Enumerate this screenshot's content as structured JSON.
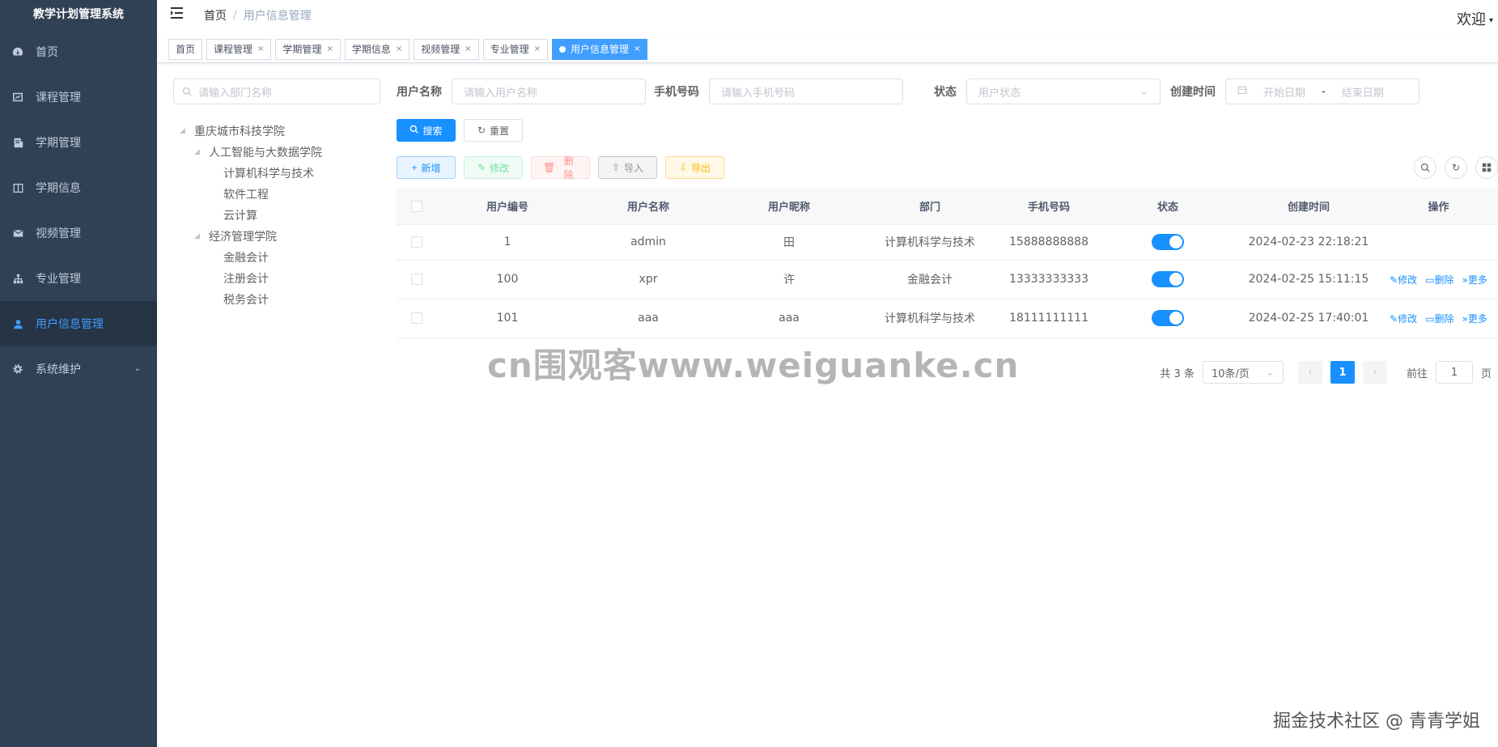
{
  "app": {
    "title": "教学计划管理系统"
  },
  "sidebar": {
    "items": [
      {
        "label": "首页",
        "icon": "dashboard-icon"
      },
      {
        "label": "课程管理",
        "icon": "chart-icon"
      },
      {
        "label": "学期管理",
        "icon": "document-icon"
      },
      {
        "label": "学期信息",
        "icon": "book-icon"
      },
      {
        "label": "视频管理",
        "icon": "mail-icon"
      },
      {
        "label": "专业管理",
        "icon": "tree-icon"
      },
      {
        "label": "用户信息管理",
        "icon": "user-icon",
        "active": true
      },
      {
        "label": "系统维护",
        "icon": "gear-icon"
      }
    ]
  },
  "header": {
    "breadcrumb_home": "首页",
    "breadcrumb_sep": "/",
    "breadcrumb_current": "用户信息管理",
    "welcome": "欢迎"
  },
  "tags": [
    {
      "label": "首页"
    },
    {
      "label": "课程管理"
    },
    {
      "label": "学期管理"
    },
    {
      "label": "学期信息"
    },
    {
      "label": "视频管理"
    },
    {
      "label": "专业管理"
    },
    {
      "label": "用户信息管理",
      "active": true
    }
  ],
  "tree": {
    "placeholder": "请输入部门名称",
    "nodes": [
      {
        "label": "重庆城市科技学院",
        "level": 0
      },
      {
        "label": "人工智能与大数据学院",
        "level": 1
      },
      {
        "label": "计算机科学与技术",
        "level": 2
      },
      {
        "label": "软件工程",
        "level": 2
      },
      {
        "label": "云计算",
        "level": 2
      },
      {
        "label": "经济管理学院",
        "level": 1
      },
      {
        "label": "金融会计",
        "level": 2
      },
      {
        "label": "注册会计",
        "level": 2
      },
      {
        "label": "税务会计",
        "level": 2
      }
    ]
  },
  "search": {
    "username_label": "用户名称",
    "username_placeholder": "请输入用户名称",
    "phone_label": "手机号码",
    "phone_placeholder": "请输入手机号码",
    "status_label": "状态",
    "status_placeholder": "用户状态",
    "created_label": "创建时间",
    "start_placeholder": "开始日期",
    "range_sep": "-",
    "end_placeholder": "结束日期",
    "search_btn": "搜索",
    "reset_btn": "重置"
  },
  "toolbar": {
    "add": "新增",
    "edit": "修改",
    "delete": "删除",
    "import": "导入",
    "export": "导出"
  },
  "table": {
    "columns": [
      "用户编号",
      "用户名称",
      "用户昵称",
      "部门",
      "手机号码",
      "状态",
      "创建时间",
      "操作"
    ],
    "rows": [
      {
        "id": "1",
        "username": "admin",
        "nickname": "田",
        "dept": "计算机科学与技术",
        "phone": "15888888888",
        "status": true,
        "created": "2024-02-23 22:18:21",
        "ops": false
      },
      {
        "id": "100",
        "username": "xpr",
        "nickname": "许",
        "dept": "金融会计",
        "phone": "13333333333",
        "status": true,
        "created": "2024-02-25 15:11:15",
        "ops": true
      },
      {
        "id": "101",
        "username": "aaa",
        "nickname": "aaa",
        "dept": "计算机科学与技术",
        "phone": "18111111111",
        "status": true,
        "created": "2024-02-25 17:40:01",
        "ops": true
      }
    ],
    "op_edit": "修改",
    "op_delete": "删除",
    "op_more": "更多"
  },
  "pagination": {
    "total": "共 3 条",
    "page_size": "10条/页",
    "current_page": "1",
    "goto_label": "前往",
    "goto_value": "1",
    "page_suffix": "页"
  },
  "watermark": "cn围观客www.weiguanke.cn",
  "credit": "掘金技术社区 @ 青青学姐",
  "colors": {
    "sidebar_bg": "#304156",
    "primary": "#1890ff",
    "active_text": "#409eff"
  }
}
